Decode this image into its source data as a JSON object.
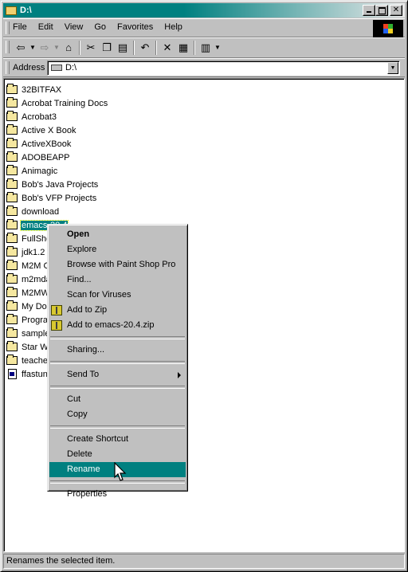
{
  "window": {
    "title": "D:\\"
  },
  "menu": [
    "File",
    "Edit",
    "View",
    "Go",
    "Favorites",
    "Help"
  ],
  "toolbar": {
    "icons": [
      "back-icon",
      "forward-icon",
      "up-folder-icon",
      "cut-icon",
      "copy-icon",
      "paste-icon",
      "undo-icon",
      "delete-icon",
      "properties-icon",
      "views-icon"
    ]
  },
  "address": {
    "label": "Address",
    "value": "D:\\"
  },
  "files": [
    {
      "name": "32BITFAX",
      "type": "folder"
    },
    {
      "name": "Acrobat Training Docs",
      "type": "folder"
    },
    {
      "name": "Acrobat3",
      "type": "folder"
    },
    {
      "name": "Active X Book",
      "type": "folder"
    },
    {
      "name": "ActiveXBook",
      "type": "folder"
    },
    {
      "name": "ADOBEAPP",
      "type": "folder"
    },
    {
      "name": "Animagic",
      "type": "folder"
    },
    {
      "name": "Bob's Java Projects",
      "type": "folder"
    },
    {
      "name": "Bob's VFP Projects",
      "type": "folder"
    },
    {
      "name": "download",
      "type": "folder"
    },
    {
      "name": "emacs-20.4",
      "type": "folder",
      "selected": true
    },
    {
      "name": "FullSho",
      "type": "folder"
    },
    {
      "name": "jdk1.2",
      "type": "folder"
    },
    {
      "name": "M2M C",
      "type": "folder"
    },
    {
      "name": "m2mda",
      "type": "folder"
    },
    {
      "name": "M2MW",
      "type": "folder"
    },
    {
      "name": "My Doc",
      "type": "folder"
    },
    {
      "name": "Progra",
      "type": "folder"
    },
    {
      "name": "sample",
      "type": "folder"
    },
    {
      "name": "Star W",
      "type": "folder"
    },
    {
      "name": "teache",
      "type": "folder"
    },
    {
      "name": "ffastun",
      "type": "file"
    }
  ],
  "context_menu": {
    "groups": [
      [
        {
          "label": "Open",
          "bold": true
        },
        {
          "label": "Explore"
        },
        {
          "label": "Browse with Paint Shop Pro"
        },
        {
          "label": "Find..."
        },
        {
          "label": "Scan for Viruses"
        },
        {
          "label": "Add to Zip",
          "icon": "zip-icon"
        },
        {
          "label": "Add to emacs-20.4.zip",
          "icon": "zip-icon"
        }
      ],
      [
        {
          "label": "Sharing..."
        }
      ],
      [
        {
          "label": "Send To",
          "submenu": true
        }
      ],
      [
        {
          "label": "Cut"
        },
        {
          "label": "Copy"
        }
      ],
      [
        {
          "label": "Create Shortcut"
        },
        {
          "label": "Delete"
        },
        {
          "label": "Rename",
          "highlighted": true
        }
      ],
      [
        {
          "label": "Properties"
        }
      ]
    ]
  },
  "status": {
    "text": "Renames the selected item."
  }
}
